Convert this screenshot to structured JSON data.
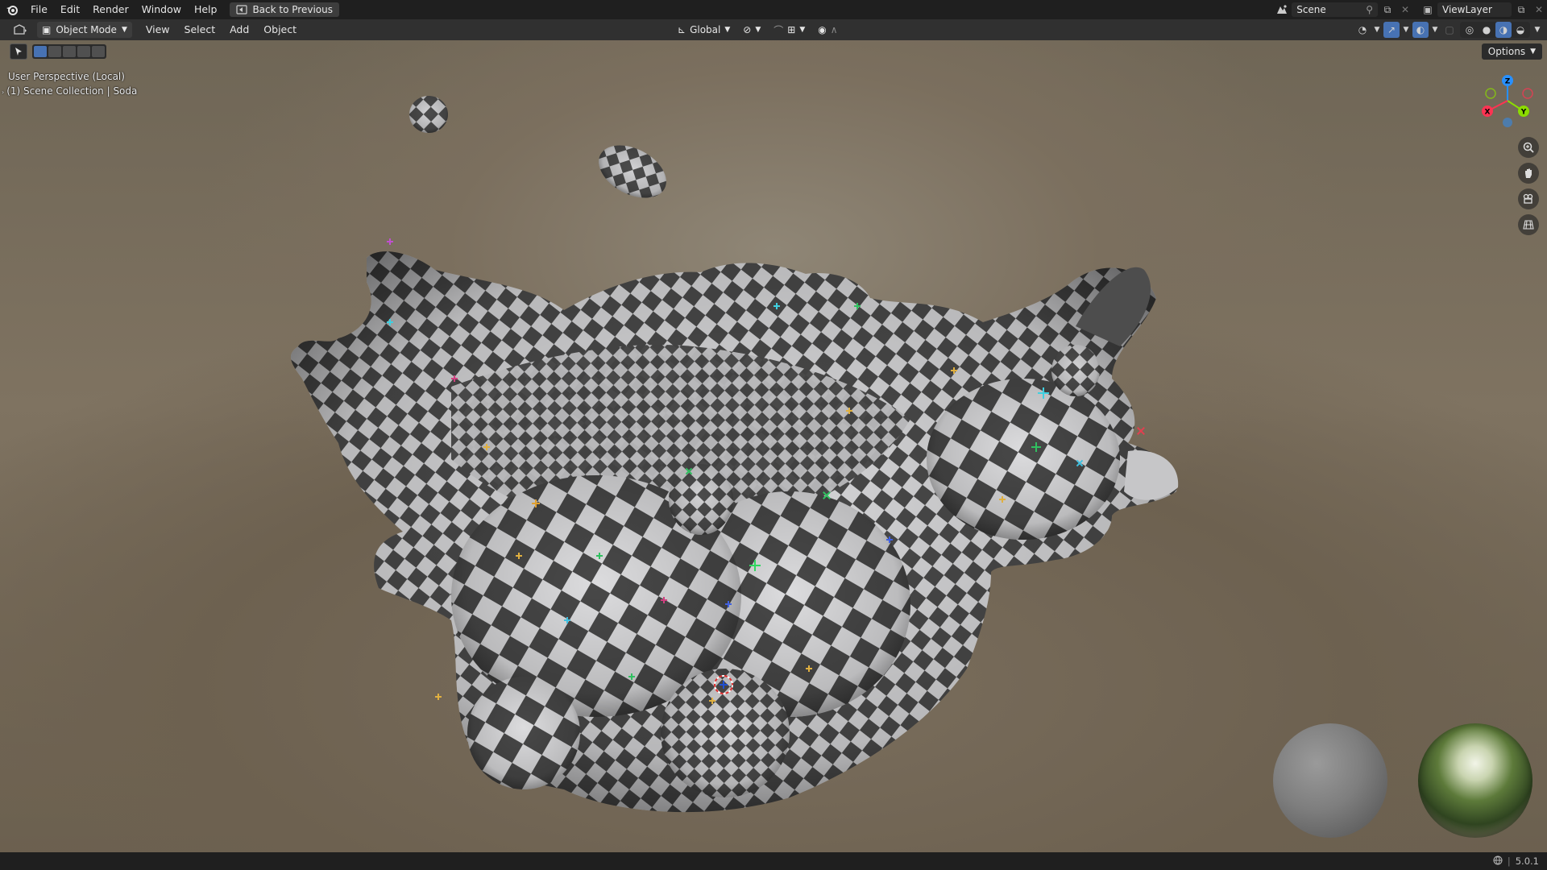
{
  "menu": {
    "items": [
      "File",
      "Edit",
      "Render",
      "Window",
      "Help"
    ],
    "back_label": "Back to Previous"
  },
  "topbar_right": {
    "scene": "Scene",
    "view_layer": "ViewLayer"
  },
  "header": {
    "mode": "Object Mode",
    "menus": [
      "View",
      "Select",
      "Add",
      "Object"
    ],
    "transform_orientation": "Global"
  },
  "options_label": "Options",
  "viewport": {
    "perspective_label": "User Perspective (Local)",
    "collection_label": "(1) Scene Collection | Soda"
  },
  "gizmo": {
    "x": "X",
    "y": "Y",
    "z": "Z",
    "x_color": "#ff3352",
    "y_color": "#8bdc00",
    "z_color": "#2890ff"
  },
  "status": {
    "version": "5.0.1"
  },
  "colors": {
    "accent": "#4772b3",
    "checker_dark": "#4a4a4a",
    "checker_light": "#d8d8da"
  }
}
